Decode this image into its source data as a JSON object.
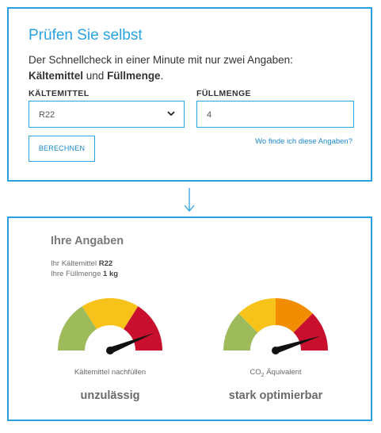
{
  "check": {
    "title": "Prüfen Sie selbst",
    "intro_line1": "Der Schnellcheck in einer Minute mit nur zwei Angaben:",
    "intro_bold1": "Kältemittel",
    "intro_connector": " und ",
    "intro_bold2": "Füllmenge",
    "intro_period": ".",
    "refrigerant_label": "KÄLTEMITTEL",
    "refrigerant_value": "R22",
    "amount_label": "FÜLLMENGE",
    "amount_value": "4",
    "submit_label": "BERECHNEN",
    "help_link": "Wo finde ich diese Angaben?"
  },
  "result": {
    "title": "Ihre Angaben",
    "refrigerant_prefix": "Ihr Kältemittel ",
    "refrigerant_value": "R22",
    "amount_prefix": "Ihre Füllmenge ",
    "amount_value": "1 kg",
    "gauge1": {
      "caption": "Kältemittel nachfüllen",
      "verdict": "unzulässig",
      "level": 0.88
    },
    "gauge2": {
      "caption_main": "CO",
      "caption_sub": "2",
      "caption_rest": " Äquivalent",
      "verdict": "stark optimierbar",
      "level": 0.9
    }
  },
  "colors": {
    "accent": "#29a3e0",
    "link": "#1b88c6",
    "gauge_green": "#9dbb5a",
    "gauge_yellow": "#f7c21a",
    "gauge_orange": "#f28c00",
    "gauge_red": "#c8102e",
    "needle": "#111111"
  },
  "icons": {
    "dropdown": "chevron-down-icon",
    "flow": "arrow-down-icon"
  }
}
